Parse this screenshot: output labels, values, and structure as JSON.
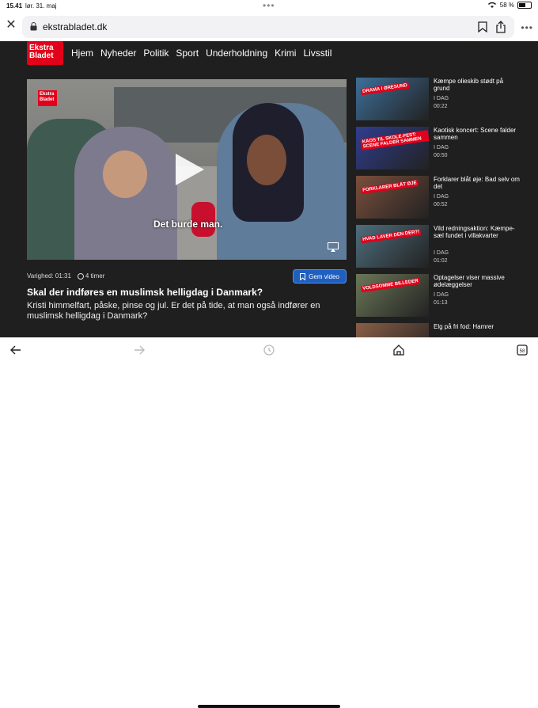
{
  "status": {
    "time": "15.41",
    "date": "lør. 31. maj",
    "battery": "58 %",
    "battery_level": 0.58
  },
  "browser": {
    "url": "ekstrabladet.dk"
  },
  "site": {
    "logo_line1": "Ekstra",
    "logo_line2": "Bladet",
    "nav": [
      "Hjem",
      "Nyheder",
      "Politik",
      "Sport",
      "Underholdning",
      "Krimi",
      "Livsstil"
    ]
  },
  "video": {
    "logo_line1": "Ekstra",
    "logo_line2": "Bladet",
    "caption": "Det burde man.",
    "duration_label": "Varighed: 01:31",
    "age": "4 timer",
    "watch_label": "Gem video",
    "headline": "Skal der indføres en muslimsk helligdag i Danmark?",
    "lead": "Kristi himmelfart, påske, pinse og jul. Er det på tide, at man også indfører en muslimsk helligdag i Danmark?"
  },
  "sidebar": [
    {
      "title": "Kæmpe olieskib stødt på grund",
      "day": "I DAG",
      "dur": "00:22",
      "thumb_label": "DRAMA I ØRESUND",
      "color": "#3d6f99"
    },
    {
      "title": "Kaotisk koncert: Scene falder sammen",
      "day": "I DAG",
      "dur": "00:50",
      "thumb_label": "KAOS TIL SKOLE-FEST: SCENE FALDER SAMMEN",
      "color": "#2f3d8e"
    },
    {
      "title": "Forklarer blåt øje: Bad selv om det",
      "day": "I DAG",
      "dur": "00:52",
      "thumb_label": "FORKLARER BLÅT ØJE",
      "color": "#7b4f3c"
    },
    {
      "title": "Vild redningsaktion: Kæmpe-sæl fundet i villakvarter",
      "day": "I DAG",
      "dur": "01:02",
      "thumb_label": "HVAD LAVER DEN DER?!",
      "color": "#4e6e7d"
    },
    {
      "title": "Optagelser viser massive ødelæggelser",
      "day": "I DAG",
      "dur": "01:13",
      "thumb_label": "VOLDSOMME BILLEDER",
      "color": "#6b7758"
    },
    {
      "title": "Elg på fri fod: Hamrer",
      "day": "",
      "dur": "",
      "thumb_label": "",
      "color": "#8a5e46"
    }
  ]
}
